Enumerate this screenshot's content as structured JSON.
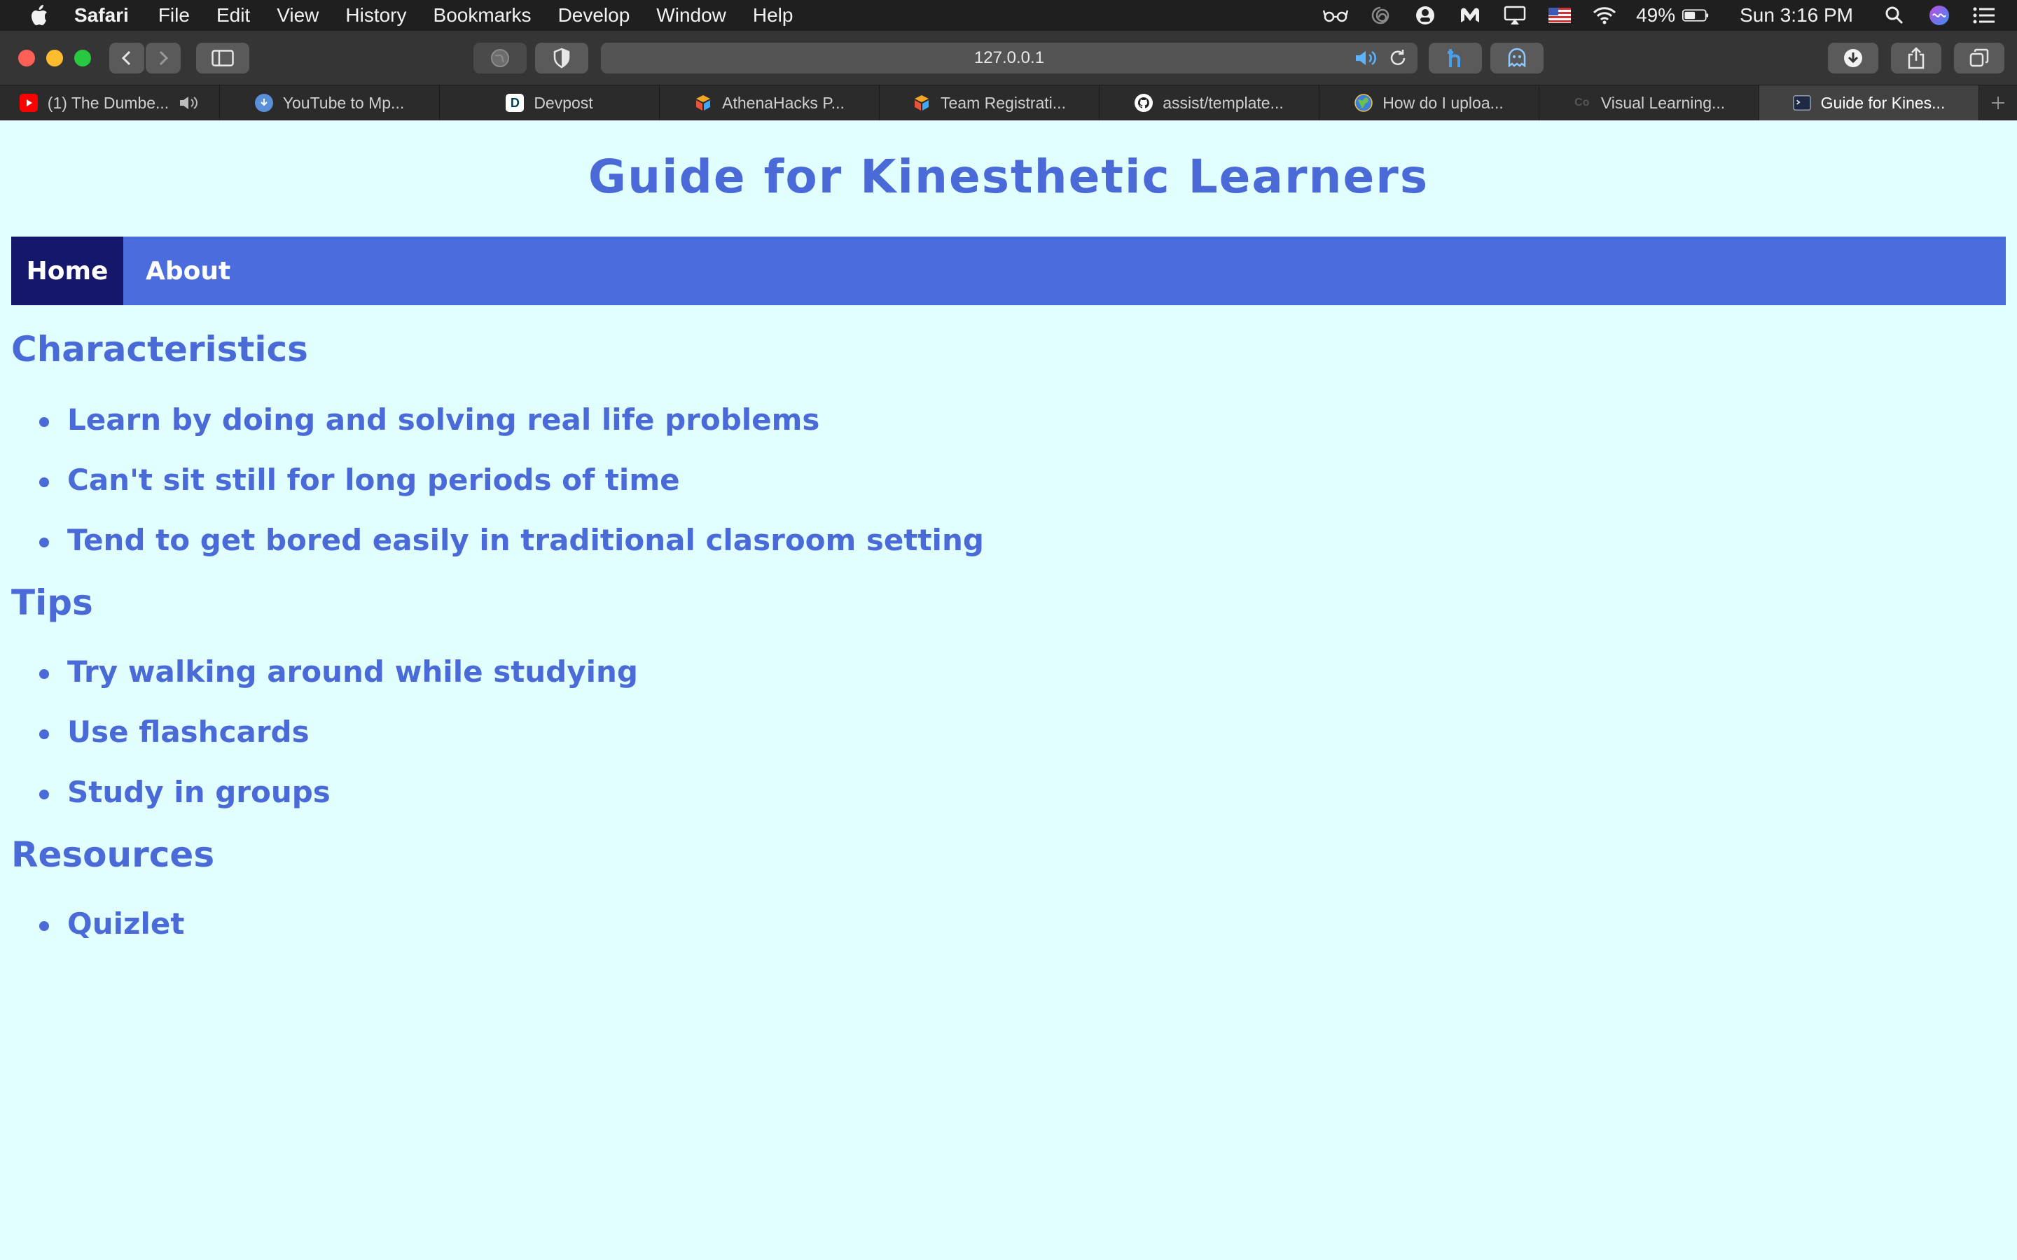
{
  "menubar": {
    "app_name": "Safari",
    "items": [
      "File",
      "Edit",
      "View",
      "History",
      "Bookmarks",
      "Develop",
      "Window",
      "Help"
    ],
    "battery": "49%",
    "clock": "Sun 3:16 PM"
  },
  "toolbar": {
    "url": "127.0.0.1"
  },
  "tabs": [
    {
      "title": "(1) The Dumbe...",
      "icon": "youtube-icon",
      "color": "#ff0000",
      "audio": true
    },
    {
      "title": "YouTube to Mp...",
      "icon": "download-icon",
      "color": "#5a8fd8"
    },
    {
      "title": "Devpost",
      "icon": "devpost-icon",
      "color": "#ffffff",
      "letter": "D"
    },
    {
      "title": "AthenaHacks P...",
      "icon": "cube-icon",
      "color": "#f5a623"
    },
    {
      "title": "Team Registrati...",
      "icon": "cube-icon",
      "color": "#f5a623"
    },
    {
      "title": "assist/template...",
      "icon": "github-icon",
      "color": "#ffffff"
    },
    {
      "title": "How do I uploa...",
      "icon": "globe-icon",
      "color": "#4caf50"
    },
    {
      "title": "Visual Learning...",
      "icon": "page-icon",
      "color": "#555555"
    },
    {
      "title": "Guide for Kines...",
      "icon": "terminal-icon",
      "color": "#888888",
      "active": true
    }
  ],
  "page": {
    "title": "Guide for Kinesthetic Learners",
    "nav": {
      "home": "Home",
      "about": "About"
    },
    "sections": [
      {
        "heading": "Characteristics",
        "items": [
          "Learn by doing and solving real life problems",
          "Can't sit still for long periods of time",
          "Tend to get bored easily in traditional clasroom setting"
        ]
      },
      {
        "heading": "Tips",
        "items": [
          "Try walking around while studying",
          "Use flashcards",
          "Study in groups"
        ]
      },
      {
        "heading": "Resources",
        "items": [
          "Quizlet"
        ]
      }
    ]
  },
  "colors": {
    "page_bg": "#e1ffff",
    "accent": "#4b6cdc",
    "nav_active": "#15186a",
    "text": "#4a6ad8"
  }
}
